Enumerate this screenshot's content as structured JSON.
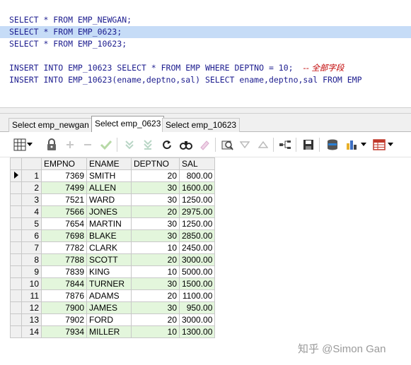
{
  "editor": {
    "lines": [
      {
        "text": "SELECT * FROM EMP_NEWGAN;",
        "comment": "",
        "selected": false
      },
      {
        "text": "SELECT * FROM EMP_0623;",
        "comment": "",
        "selected": true
      },
      {
        "text": "SELECT * FROM EMP_10623;",
        "comment": "",
        "selected": false
      },
      {
        "text": "",
        "comment": "",
        "selected": false
      },
      {
        "text": "INSERT INTO EMP_10623 SELECT * FROM EMP WHERE DEPTNO = 10;  ",
        "comment": "-- 全部字段",
        "selected": false
      },
      {
        "text": "INSERT INTO EMP_10623(ename,deptno,sal) SELECT ename,deptno,sal FROM EMP",
        "comment": "",
        "selected": false
      }
    ]
  },
  "tabs": [
    {
      "label": "Select emp_newgan",
      "active": false
    },
    {
      "label": "Select emp_0623",
      "active": true
    },
    {
      "label": "Select emp_10623",
      "active": false
    }
  ],
  "toolbar": {
    "icons": [
      "grid-view-icon",
      "dropdown-arrow-icon",
      "lock-icon",
      "add-record-icon",
      "delete-record-icon",
      "post-changes-icon",
      "fetch-next-icon",
      "fetch-last-icon",
      "refresh-icon",
      "find-icon",
      "clear-icon",
      "query-by-example-icon",
      "filter-down-icon",
      "filter-up-icon",
      "link-icon",
      "save-icon",
      "export-icon",
      "chart-icon",
      "dropdown-arrow-icon",
      "table-icon",
      "dropdown-arrow-icon"
    ]
  },
  "grid": {
    "columns": [
      "EMPNO",
      "ENAME",
      "DEPTNO",
      "SAL"
    ],
    "rows": [
      {
        "n": "1",
        "empno": "7369",
        "ename": "SMITH",
        "deptno": "20",
        "sal": "800.00"
      },
      {
        "n": "2",
        "empno": "7499",
        "ename": "ALLEN",
        "deptno": "30",
        "sal": "1600.00"
      },
      {
        "n": "3",
        "empno": "7521",
        "ename": "WARD",
        "deptno": "30",
        "sal": "1250.00"
      },
      {
        "n": "4",
        "empno": "7566",
        "ename": "JONES",
        "deptno": "20",
        "sal": "2975.00"
      },
      {
        "n": "5",
        "empno": "7654",
        "ename": "MARTIN",
        "deptno": "30",
        "sal": "1250.00"
      },
      {
        "n": "6",
        "empno": "7698",
        "ename": "BLAKE",
        "deptno": "30",
        "sal": "2850.00"
      },
      {
        "n": "7",
        "empno": "7782",
        "ename": "CLARK",
        "deptno": "10",
        "sal": "2450.00"
      },
      {
        "n": "8",
        "empno": "7788",
        "ename": "SCOTT",
        "deptno": "20",
        "sal": "3000.00"
      },
      {
        "n": "9",
        "empno": "7839",
        "ename": "KING",
        "deptno": "10",
        "sal": "5000.00"
      },
      {
        "n": "10",
        "empno": "7844",
        "ename": "TURNER",
        "deptno": "30",
        "sal": "1500.00"
      },
      {
        "n": "11",
        "empno": "7876",
        "ename": "ADAMS",
        "deptno": "20",
        "sal": "1100.00"
      },
      {
        "n": "12",
        "empno": "7900",
        "ename": "JAMES",
        "deptno": "30",
        "sal": "950.00"
      },
      {
        "n": "13",
        "empno": "7902",
        "ename": "FORD",
        "deptno": "20",
        "sal": "3000.00"
      },
      {
        "n": "14",
        "empno": "7934",
        "ename": "MILLER",
        "deptno": "10",
        "sal": "1300.00"
      }
    ]
  },
  "watermark": "知乎 @Simon Gan",
  "colors": {
    "selection": "#c6dcf7",
    "keyword": "#1d1d8f",
    "comment": "#c00000",
    "row_alt": "#e3f6dc"
  }
}
